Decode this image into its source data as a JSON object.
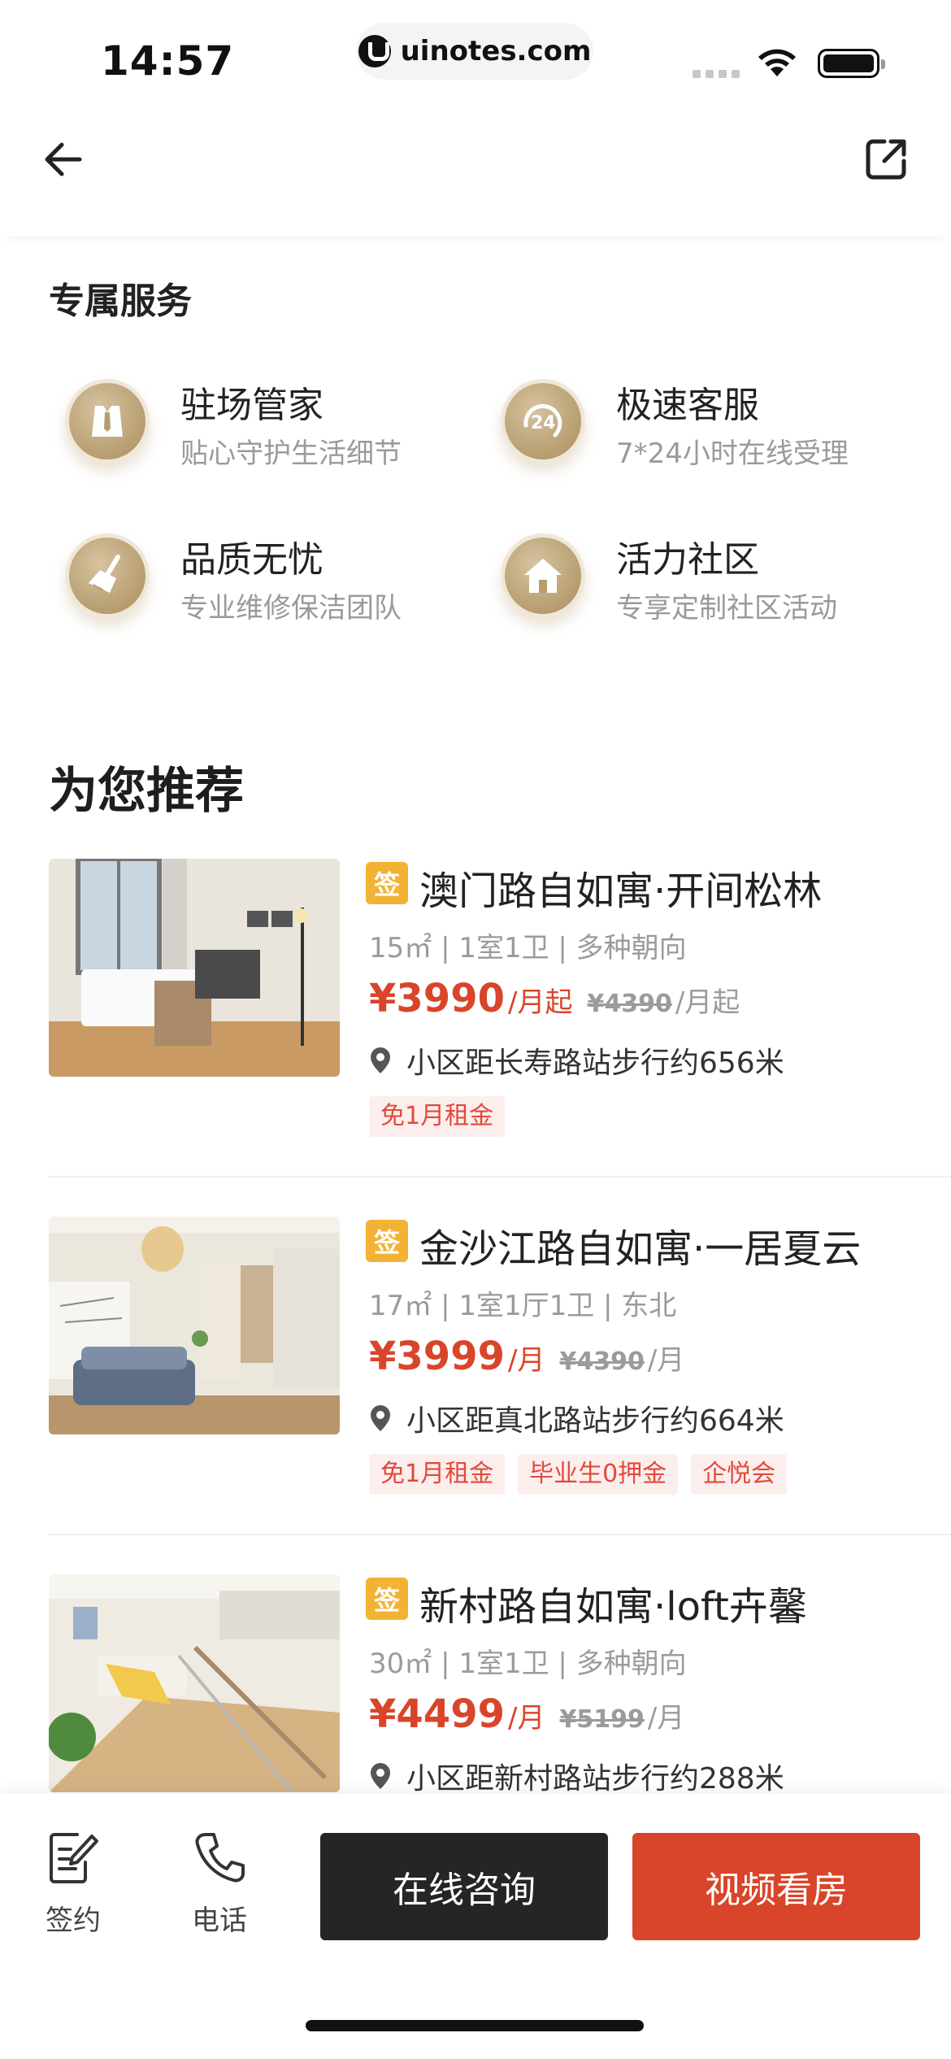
{
  "status_bar": {
    "time": "14:57",
    "url": "uinotes.com"
  },
  "services": {
    "title": "专属服务",
    "items": [
      {
        "name": "驻场管家",
        "desc": "贴心守护生活细节",
        "icon": "butler-vest-icon"
      },
      {
        "name": "极速客服",
        "desc": "7*24小时在线受理",
        "icon": "24h-service-icon"
      },
      {
        "name": "品质无忧",
        "desc": "专业维修保洁团队",
        "icon": "broom-icon"
      },
      {
        "name": "活力社区",
        "desc": "专享定制社区活动",
        "icon": "house-icon"
      }
    ]
  },
  "recommend": {
    "title": "为您推荐",
    "sign_badge": "签",
    "listings": [
      {
        "title": "澳门路自如寓·开间松林",
        "meta": "15㎡ | 1室1卫 | 多种朝向",
        "price": "¥3990",
        "price_unit": "/月起",
        "original_price": "¥4390",
        "original_unit": "/月起",
        "location": "小区距长寿路站步行约656米",
        "tags": [
          "免1月租金"
        ]
      },
      {
        "title": "金沙江路自如寓·一居夏云",
        "meta": "17㎡ | 1室1厅1卫 | 东北",
        "price": "¥3999",
        "price_unit": "/月",
        "original_price": "¥4390",
        "original_unit": "/月",
        "location": "小区距真北路站步行约664米",
        "tags": [
          "免1月租金",
          "毕业生0押金",
          "企悦会"
        ]
      },
      {
        "title": "新村路自如寓·loft卉馨",
        "meta": "30㎡ | 1室1卫 | 多种朝向",
        "price": "¥4499",
        "price_unit": "/月",
        "original_price": "¥5199",
        "original_unit": "/月",
        "location": "小区距新村路站步行约288米",
        "tags": []
      }
    ]
  },
  "bottom_bar": {
    "sign_label": "签约",
    "phone_label": "电话",
    "consult_label": "在线咨询",
    "video_label": "视频看房"
  },
  "colors": {
    "accent_red": "#d9452a",
    "gold": "#b79d70",
    "badge_yellow": "#f2b233",
    "dark_button": "#252525"
  }
}
